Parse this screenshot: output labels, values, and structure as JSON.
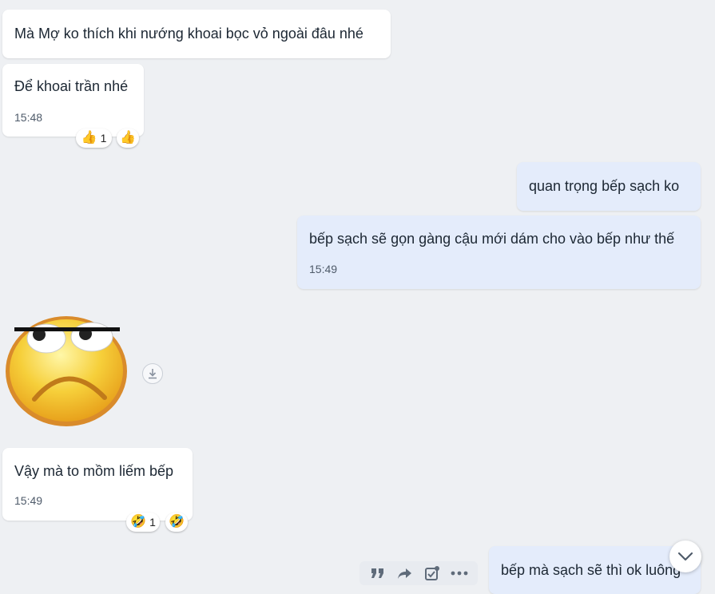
{
  "messages": [
    {
      "text": "Mà Mợ ko thích khi nướng khoai bọc vỏ ngoài đâu nhé"
    },
    {
      "text": "Để khoai trần nhé",
      "time": "15:48",
      "reactions": [
        {
          "emoji": "👍",
          "count": "1"
        },
        {
          "emoji": "👍"
        }
      ]
    },
    {
      "text": "quan trọng bếp sạch ko"
    },
    {
      "text": "bếp sạch sẽ gọn gàng cậu mới dám cho vào bếp như thế",
      "time": "15:49"
    },
    {
      "sticker": "unamused-face-sticker"
    },
    {
      "text": "Vậy mà to mồm liếm bếp",
      "time": "15:49",
      "reactions": [
        {
          "emoji": "🤣",
          "count": "1"
        },
        {
          "emoji": "🤣"
        }
      ]
    },
    {
      "text": "bếp mà sạch sẽ thì ok luông"
    }
  ],
  "colors": {
    "background": "#eef0f3",
    "incoming_bubble": "#ffffff",
    "outgoing_bubble": "#e4ecfb",
    "text": "#1c2733",
    "time": "#4f5b6a",
    "toolbar_icon": "#5f6b7a"
  },
  "toolbar_icons": [
    "quote-icon",
    "forward-icon",
    "todo-icon",
    "more-icon"
  ]
}
